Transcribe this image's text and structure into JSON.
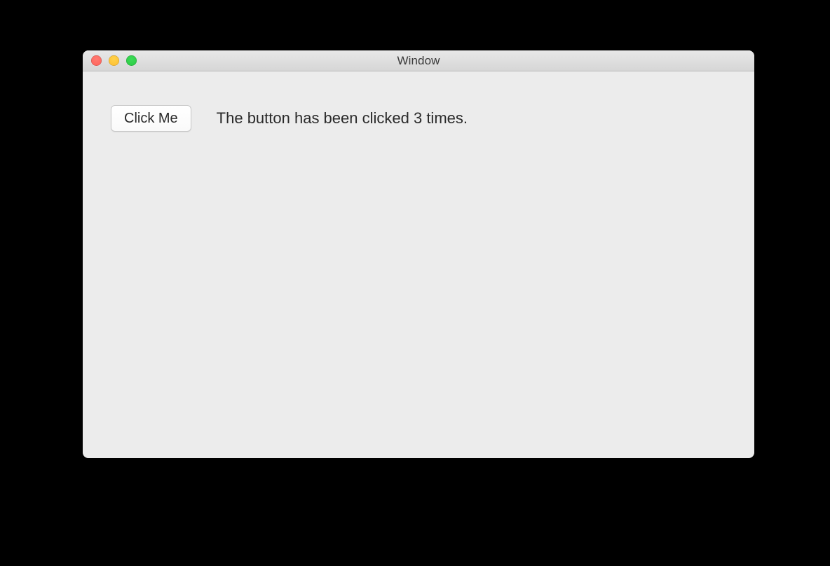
{
  "window": {
    "title": "Window"
  },
  "main": {
    "button_label": "Click Me",
    "status_text": "The button has been clicked 3 times."
  }
}
